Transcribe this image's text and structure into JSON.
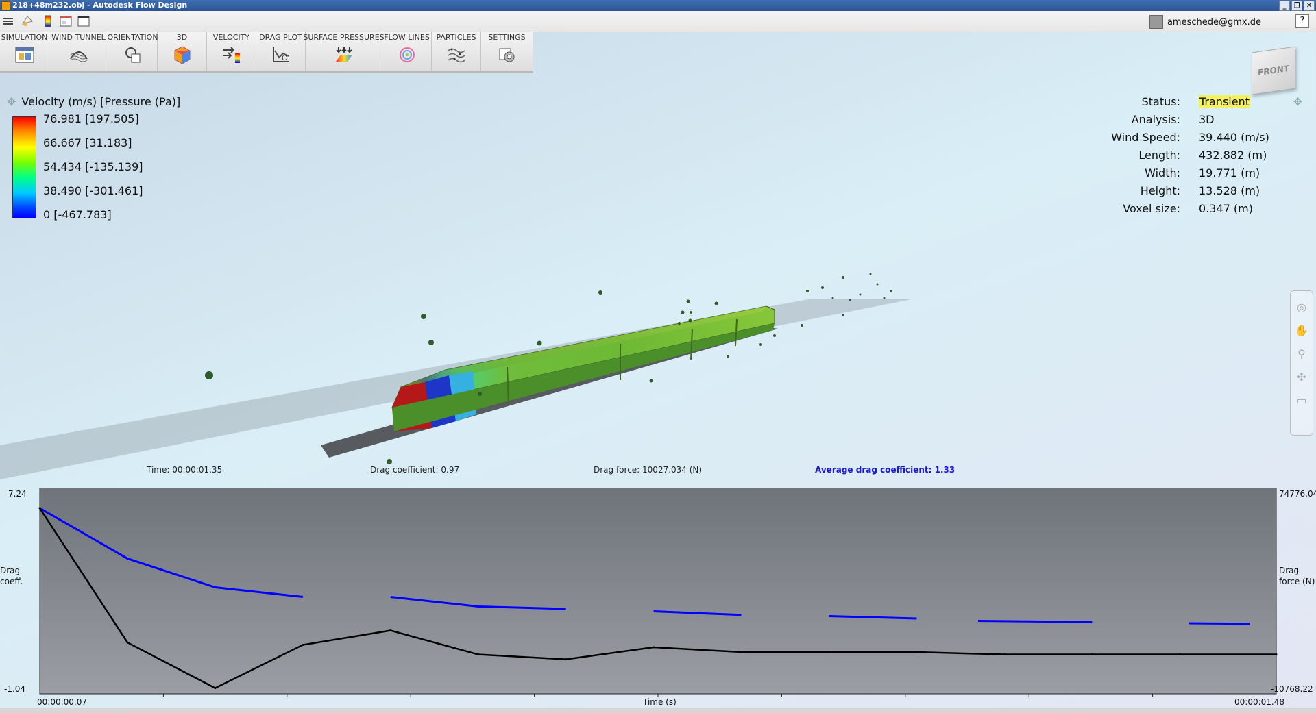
{
  "window": {
    "title": "218+48m232.obj - Autodesk Flow Design",
    "controls": [
      "_",
      "❐",
      "✕"
    ]
  },
  "menubar": {
    "user": "ameschede@gmx.de",
    "help": "?"
  },
  "ribbon": {
    "tabs": [
      {
        "label": "SIMULATION",
        "icon": "simulation-icon"
      },
      {
        "label": "WIND TUNNEL",
        "icon": "wind-tunnel-icon"
      },
      {
        "label": "ORIENTATION",
        "icon": "orientation-icon"
      },
      {
        "label": "3D",
        "icon": "3d-icon"
      },
      {
        "label": "VELOCITY",
        "icon": "velocity-icon"
      },
      {
        "label": "DRAG PLOT",
        "icon": "drag-plot-icon"
      },
      {
        "label": "SURFACE PRESSURES",
        "icon": "surface-pressures-icon"
      },
      {
        "label": "FLOW LINES",
        "icon": "flow-lines-icon"
      },
      {
        "label": "PARTICLES",
        "icon": "particles-icon"
      },
      {
        "label": "SETTINGS",
        "icon": "settings-icon"
      }
    ]
  },
  "legend": {
    "title": "Velocity (m/s) [Pressure (Pa)]",
    "ticks": [
      "76.981 [197.505]",
      "66.667 [31.183]",
      "54.434 [-135.139]",
      "38.490 [-301.461]",
      "0 [-467.783]"
    ]
  },
  "info": {
    "status_label": "Status:",
    "status_value": "Transient",
    "analysis_label": "Analysis:",
    "analysis_value": "3D",
    "wind_label": "Wind Speed:",
    "wind_value": "39.440 (m/s)",
    "length_label": "Length:",
    "length_value": "432.882 (m)",
    "width_label": "Width:",
    "width_value": "19.771 (m)",
    "height_label": "Height:",
    "height_value": "13.528 (m)",
    "voxel_label": "Voxel size:",
    "voxel_value": "0.347 (m)"
  },
  "viewcube": {
    "face": "FRONT"
  },
  "stats": {
    "time": "Time: 00:00:01.35",
    "drag_coefficient": "Drag coefficient: 0.97",
    "drag_force": "Drag force: 10027.034 (N)",
    "avg_drag": "Average drag coefficient: 1.33"
  },
  "plot": {
    "y_left_max": "7.24",
    "y_left_min": "-1.04",
    "y_right_max": "74776.04",
    "y_right_min": "-10768.22",
    "y_left_label_1": "Drag",
    "y_left_label_2": "coeff.",
    "y_right_label_1": "Drag",
    "y_right_label_2": "force (N)",
    "x_start": "00:00:00.07",
    "x_end": "00:00:01.48",
    "x_label": "Time (s)"
  },
  "chart_data": {
    "type": "line",
    "x": [
      0.07,
      0.17,
      0.27,
      0.37,
      0.47,
      0.57,
      0.67,
      0.77,
      0.87,
      0.97,
      1.07,
      1.17,
      1.27,
      1.37,
      1.48
    ],
    "ylim": [
      -1.04,
      7.24
    ],
    "series": [
      {
        "name": "",
        "color": "#000000",
        "values": [
          6.7,
          1.1,
          -0.8,
          1.0,
          1.6,
          0.6,
          0.4,
          0.9,
          0.7,
          0.7,
          0.7,
          0.6,
          0.6,
          0.6,
          0.6
        ]
      }
    ],
    "average_segments": {
      "color": "#0000ff",
      "segments": [
        [
          [
            0.07,
            6.7
          ],
          [
            0.17,
            4.6
          ],
          [
            0.27,
            3.4
          ],
          [
            0.37,
            3.0
          ]
        ],
        [
          [
            0.47,
            3.0
          ],
          [
            0.57,
            2.6
          ],
          [
            0.67,
            2.5
          ]
        ],
        [
          [
            0.77,
            2.4
          ],
          [
            0.87,
            2.25
          ]
        ],
        [
          [
            0.97,
            2.2
          ],
          [
            1.07,
            2.1
          ]
        ],
        [
          [
            1.14,
            2.0
          ],
          [
            1.27,
            1.95
          ]
        ],
        [
          [
            1.38,
            1.9
          ],
          [
            1.45,
            1.88
          ]
        ]
      ]
    }
  }
}
